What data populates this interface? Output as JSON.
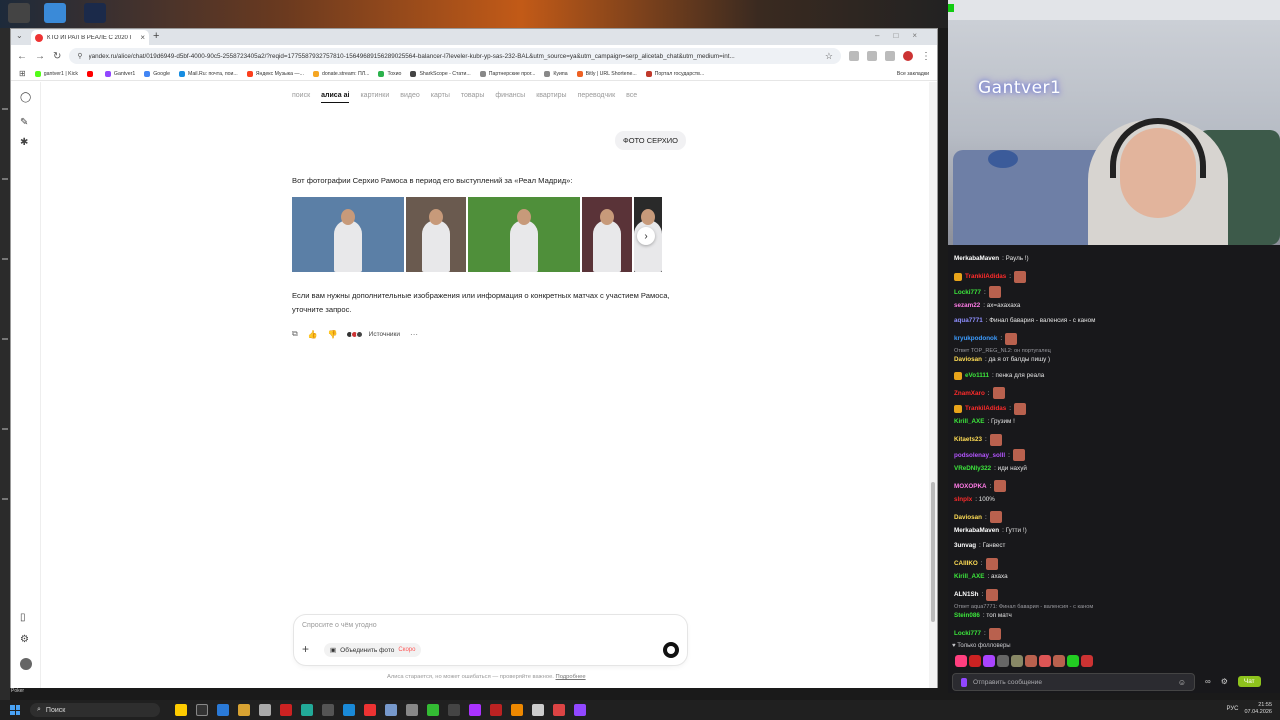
{
  "browser": {
    "tab_title": "КТО ИГРАЛ В РЕАЛЕ С 2020 Г",
    "url": "yandex.ru/alice/chat/019d6949-d5bf-4000-90c5-2558723405a2/?reqid=1775587932757810-15649689156289025564-balancer-l7leveler-kubr-yp-sas-232-BAL&utm_source=ya&utm_campaign=serp_alicetab_chat&utm_medium=int...",
    "bookmarks": [
      {
        "label": "gantver1 | Kick",
        "color": "#53fc18"
      },
      {
        "label": "",
        "color": "#ff0000"
      },
      {
        "label": "Gantver1",
        "color": "#9147ff"
      },
      {
        "label": "Google",
        "color": "#4285f4"
      },
      {
        "label": "Mail.Ru: почта, пои...",
        "color": "#168de2"
      },
      {
        "label": "Яндекс Музыка —...",
        "color": "#fc3f1d"
      },
      {
        "label": "donate.stream: ПЛ...",
        "color": "#f5a623"
      },
      {
        "label": "Тохио",
        "color": "#2bb24c"
      },
      {
        "label": "SharkScope - Стати...",
        "color": "#444444"
      },
      {
        "label": "Партнерские прог...",
        "color": "#888888"
      },
      {
        "label": "Куипа",
        "color": "#888888"
      },
      {
        "label": "Bitly | URL Shortene...",
        "color": "#ee6123"
      },
      {
        "label": "Портал государств...",
        "color": "#c0392b"
      }
    ],
    "all_bookmarks": "Все закладки"
  },
  "page": {
    "nav_tabs": [
      {
        "label": "поиск",
        "active": false
      },
      {
        "label": "алиса ai",
        "active": true
      },
      {
        "label": "картинки",
        "active": false
      },
      {
        "label": "видео",
        "active": false
      },
      {
        "label": "карты",
        "active": false
      },
      {
        "label": "товары",
        "active": false
      },
      {
        "label": "финансы",
        "active": false
      },
      {
        "label": "квартиры",
        "active": false
      },
      {
        "label": "переводчик",
        "active": false
      },
      {
        "label": "все",
        "active": false
      }
    ],
    "user_message": "ФОТО СЕРХИО",
    "answer_intro": "Вот фотографии Серхио Рамоса в период его выступлений за «Реал Мадрид»:",
    "photos": [
      {
        "name": "photo-1",
        "bg": "#5b7fa6",
        "w": 112
      },
      {
        "name": "photo-2",
        "bg": "#6a5a4f",
        "w": 60
      },
      {
        "name": "photo-3",
        "bg": "#4f8f3a",
        "w": 112
      },
      {
        "name": "photo-4",
        "bg": "#5a3338",
        "w": 50
      },
      {
        "name": "photo-5",
        "bg": "#2a2a2a",
        "w": 28
      }
    ],
    "answer_more": "Если вам нужны дополнительные изображения или информация о конкретных матчах с участием Рамоса, уточните запрос.",
    "sources_label": "Источники",
    "composer_placeholder": "Спросите о чём угодно",
    "merge_photo_label": "Объединить фото",
    "merge_badge": "Скоро",
    "disclaimer_text": "Алиса старается, но может ошибаться — проверяйте важное.",
    "disclaimer_link": "Подробнее"
  },
  "stream": {
    "cam_name": "Gantver1",
    "chat": [
      {
        "user": "MerkabaMaven",
        "color": "#ffffff",
        "msg": ": Рауль !)",
        "badge": false,
        "emote": false,
        "reply": ""
      },
      {
        "user": "TrankilAdidas",
        "color": "#ff2b2b",
        "msg": ":",
        "badge": true,
        "emote": true,
        "reply": ""
      },
      {
        "user": "Locki777",
        "color": "#3ce63c",
        "msg": ":",
        "badge": false,
        "emote": true,
        "reply": ""
      },
      {
        "user": "sezam22",
        "color": "#ff7be6",
        "msg": ": ах=ахахаха",
        "badge": false,
        "emote": false,
        "reply": ""
      },
      {
        "user": "aqua7771",
        "color": "#8f8fff",
        "msg": ": Финал бавария - валенсия - с каном",
        "badge": false,
        "emote": false,
        "reply": ""
      },
      {
        "user": "kryukpodonok",
        "color": "#3c9cff",
        "msg": ":",
        "badge": false,
        "emote": true,
        "reply": ""
      },
      {
        "user": "Daviosan",
        "color": "#ffdd55",
        "msg": ": да я от балды пишу )",
        "badge": false,
        "emote": false,
        "reply": "Ответ TOP_REG_NL2: он португалец"
      },
      {
        "user": "eVo1111",
        "color": "#3ce63c",
        "msg": ": пенка для реала",
        "badge": true,
        "emote": false,
        "reply": ""
      },
      {
        "user": "ZnamXaro",
        "color": "#ff2b2b",
        "msg": ":",
        "badge": false,
        "emote": true,
        "reply": ""
      },
      {
        "user": "TrankilAdidas",
        "color": "#ff2b2b",
        "msg": ":",
        "badge": true,
        "emote": true,
        "reply": ""
      },
      {
        "user": "Kirill_AXE",
        "color": "#3ce63c",
        "msg": ": Грузим !",
        "badge": false,
        "emote": false,
        "reply": ""
      },
      {
        "user": "Kitaets23",
        "color": "#ffdd55",
        "msg": ":",
        "badge": false,
        "emote": true,
        "reply": ""
      },
      {
        "user": "podsolenay_solll",
        "color": "#b455ff",
        "msg": ":",
        "badge": false,
        "emote": true,
        "reply": ""
      },
      {
        "user": "VReDNIy322",
        "color": "#3ce63c",
        "msg": ": иди нахуй",
        "badge": false,
        "emote": false,
        "reply": ""
      },
      {
        "user": "MOXOPKA",
        "color": "#ff7be6",
        "msg": ":",
        "badge": false,
        "emote": true,
        "reply": ""
      },
      {
        "user": "slnplx",
        "color": "#ff2b2b",
        "msg": ": 100%",
        "badge": false,
        "emote": false,
        "reply": ""
      },
      {
        "user": "Daviosan",
        "color": "#ffdd55",
        "msg": ":",
        "badge": false,
        "emote": true,
        "reply": ""
      },
      {
        "user": "MerkabaMaven",
        "color": "#ffffff",
        "msg": ": Гутти !)",
        "badge": false,
        "emote": false,
        "reply": ""
      },
      {
        "user": "3unvag",
        "color": "#ffffff",
        "msg": ": Ганвест",
        "badge": false,
        "emote": false,
        "reply": ""
      },
      {
        "user": "CAIIIKO",
        "color": "#ffdd55",
        "msg": ":",
        "badge": false,
        "emote": true,
        "reply": ""
      },
      {
        "user": "Kirill_AXE",
        "color": "#3ce63c",
        "msg": ": ахаха",
        "badge": false,
        "emote": false,
        "reply": ""
      },
      {
        "user": "ALN1Sh",
        "color": "#ffffff",
        "msg": ":",
        "badge": false,
        "emote": true,
        "reply": ""
      },
      {
        "user": "Stein086",
        "color": "#3ce63c",
        "msg": ": топ матч",
        "badge": false,
        "emote": false,
        "reply": "Ответ aqua7771: Финал бавария - валенсия - с каном"
      },
      {
        "user": "Locki777",
        "color": "#3ce63c",
        "msg": ":",
        "badge": false,
        "emote": true,
        "reply": ""
      }
    ],
    "followers_only": "Только фолловеры",
    "chat_input_placeholder": "Отправить сообщение",
    "chat_button": "Чат"
  },
  "taskbar": {
    "search_label": "Поиск",
    "lang": "РУС",
    "time": "21:55",
    "date": "07.04.2026",
    "poker_label": "Poker"
  },
  "colors": {
    "accent_green": "#8ec31d",
    "twitch_purple": "#9147ff"
  }
}
